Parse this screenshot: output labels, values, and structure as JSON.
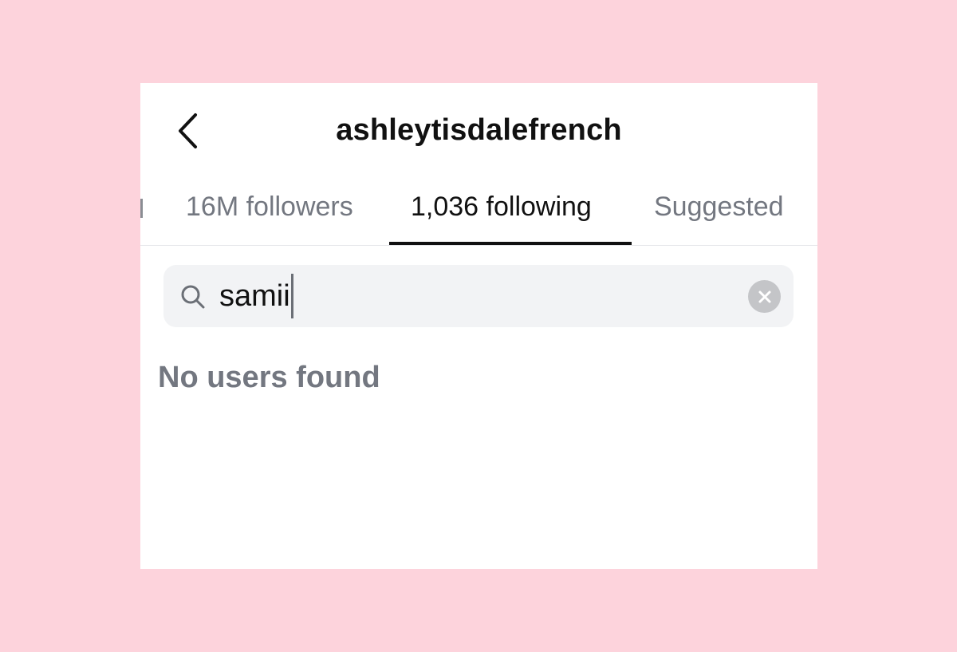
{
  "header": {
    "back_icon": "chevron-left-icon",
    "username": "ashleytisdalefrench"
  },
  "tabs": [
    {
      "label": "16M followers",
      "active": false
    },
    {
      "label": "1,036 following",
      "active": true
    },
    {
      "label": "Suggested",
      "active": false
    }
  ],
  "search": {
    "icon": "search-icon",
    "value": "samii",
    "clear_icon": "clear-circle-icon"
  },
  "results": {
    "empty_message": "No users found"
  },
  "colors": {
    "background": "#fdd3dc",
    "card": "#ffffff",
    "text_primary": "#111111",
    "text_secondary": "#737780",
    "search_bg": "#f2f3f5"
  }
}
